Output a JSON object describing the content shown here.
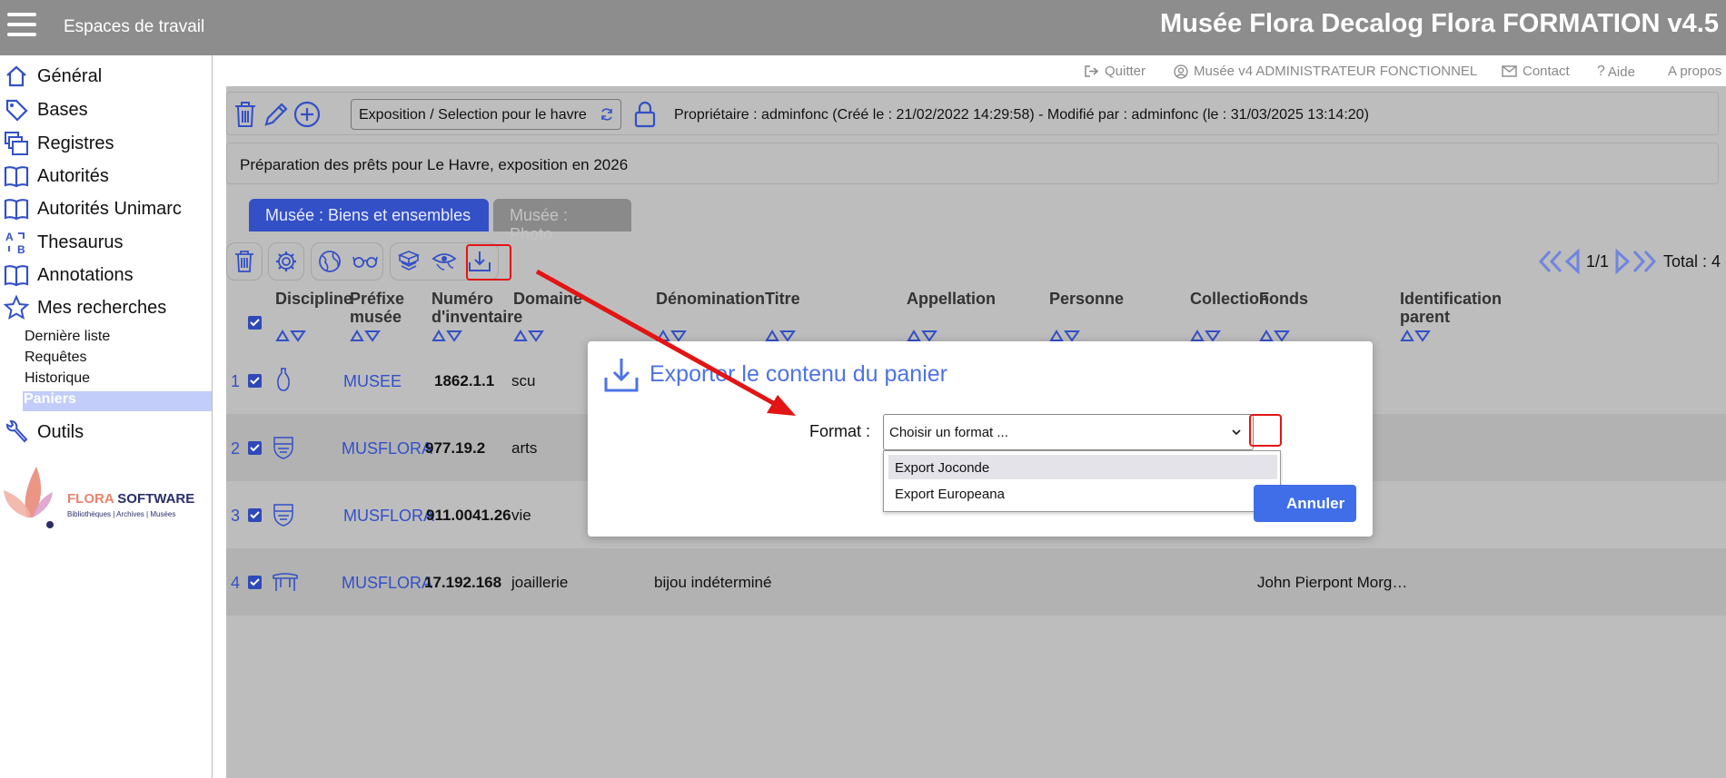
{
  "topbar": {
    "workspaces_label": "Espaces de travail",
    "app_title": "Musée Flora Decalog Flora FORMATION v4.5"
  },
  "sidebar": {
    "items": [
      {
        "label": "Général",
        "icon": "home-icon"
      },
      {
        "label": "Bases",
        "icon": "tag-icon"
      },
      {
        "label": "Registres",
        "icon": "registers-icon"
      },
      {
        "label": "Autorités",
        "icon": "book-icon"
      },
      {
        "label": "Autorités Unimarc",
        "icon": "book-icon"
      },
      {
        "label": "Thesaurus",
        "icon": "thesaurus-icon"
      },
      {
        "label": "Annotations",
        "icon": "book-icon"
      },
      {
        "label": "Mes recherches",
        "icon": "star-icon"
      },
      {
        "label": "Outils",
        "icon": "wrench-icon"
      }
    ],
    "sub_items": [
      "Dernière liste",
      "Requêtes",
      "Historique",
      "Paniers"
    ],
    "logo": {
      "brand": "FLORA SOFTWARE",
      "tagline": "Bibliothèques | Archives | Musées"
    }
  },
  "userbar": {
    "quit": "Quitter",
    "user": "Musée v4 ADMINISTRATEUR FONCTIONNEL",
    "contact": "Contact",
    "help": "Aide",
    "about": "A propos"
  },
  "basket": {
    "selected": "Exposition / Selection pour le havre",
    "owner_info": "Propriétaire : adminfonc (Créé le : 21/02/2022 14:29:58) - Modifié par : adminfonc (le : 31/03/2025 13:14:20)",
    "description": "Préparation des prêts pour Le Havre, exposition en 2026"
  },
  "tabs": [
    "Musée : Biens et ensembles",
    "Musée : Photo"
  ],
  "pager": {
    "page": "1/1",
    "total": "Total : 4"
  },
  "table": {
    "columns": [
      "Discipline",
      "Préfixe musée",
      "Numéro d'inventaire",
      "Domaine",
      "Dénomination",
      "Titre",
      "Appellation",
      "Personne",
      "Collection",
      "Fonds",
      "Identification parent"
    ],
    "rows": [
      {
        "num": "1",
        "prefix": "MUSEE",
        "inv": "1862.1.1",
        "domaine": "scu",
        "denomination": "",
        "fonds": "",
        "discipline_icon": "vase-icon"
      },
      {
        "num": "2",
        "prefix": "MUSFLORA",
        "inv": "977.19.2",
        "domaine": "arts",
        "denomination": "",
        "fonds": "",
        "discipline_icon": "crest-icon"
      },
      {
        "num": "3",
        "prefix": "MUSFLORA",
        "inv": "911.0041.26",
        "domaine": "vie",
        "denomination": "",
        "fonds": "",
        "discipline_icon": "crest-icon"
      },
      {
        "num": "4",
        "prefix": "MUSFLORA",
        "inv": "17.192.168",
        "domaine": "joaillerie",
        "denomination": "bijou indéterminé",
        "fonds": "John Pierpont Morg…",
        "discipline_icon": "table-icon"
      }
    ]
  },
  "dialog": {
    "title": "Exporter le contenu du panier",
    "format_label": "Format :",
    "format_placeholder": "Choisir un format ...",
    "options": [
      "Export Joconde",
      "Export Europeana"
    ],
    "cancel": "Annuler"
  },
  "colors": {
    "accent": "#3350c6",
    "annotation": "#e31414",
    "topbar": "#8d8d8d"
  }
}
